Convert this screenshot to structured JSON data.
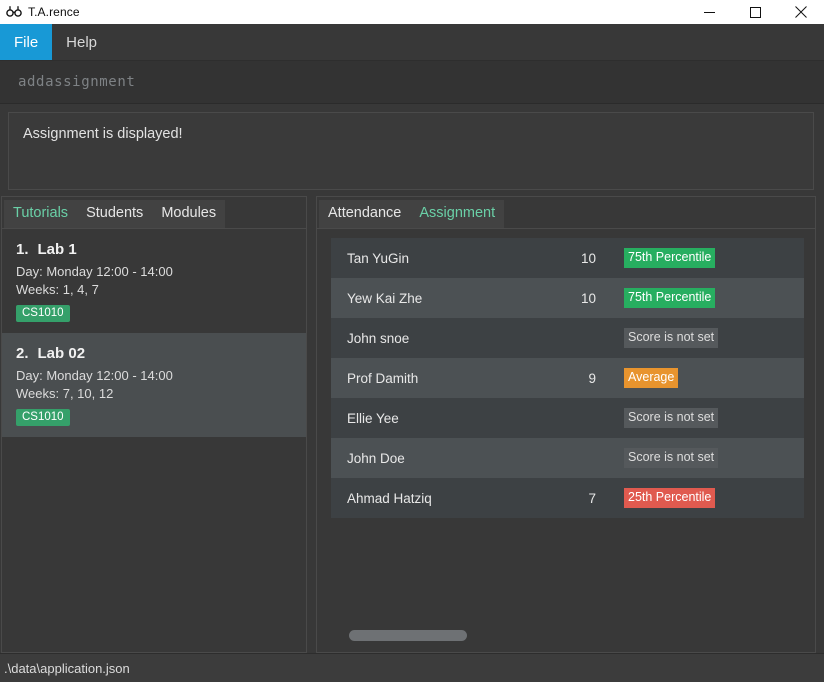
{
  "window": {
    "title": "T.A.rence",
    "app_icon": "glasses-icon",
    "controls": {
      "minimize": "minimize-icon",
      "maximize": "maximize-icon",
      "close": "close-icon"
    }
  },
  "menubar": {
    "items": [
      {
        "label": "File",
        "active": true
      },
      {
        "label": "Help",
        "active": false
      }
    ]
  },
  "command": {
    "value": "addassignment",
    "placeholder": "Enter command here..."
  },
  "result": {
    "message": "Assignment is displayed!"
  },
  "left_panel": {
    "tabs": [
      {
        "label": "Tutorials",
        "active": true
      },
      {
        "label": "Students",
        "active": false
      },
      {
        "label": "Modules",
        "active": false
      }
    ],
    "tutorials": [
      {
        "index": "1.",
        "name": "Lab 1",
        "day": "Day: Monday 12:00 - 14:00",
        "weeks": "Weeks: 1, 4, 7",
        "module": "CS1010"
      },
      {
        "index": "2.",
        "name": "Lab 02",
        "day": "Day: Monday 12:00 - 14:00",
        "weeks": "Weeks: 7, 10, 12",
        "module": "CS1010"
      }
    ]
  },
  "right_panel": {
    "tabs": [
      {
        "label": "Attendance",
        "active": false
      },
      {
        "label": "Assignment",
        "active": true
      }
    ],
    "rows": [
      {
        "name": "Tan YuGin",
        "score": "10",
        "status": "75th Percentile",
        "status_kind": "good"
      },
      {
        "name": "Yew Kai Zhe",
        "score": "10",
        "status": "75th Percentile",
        "status_kind": "good"
      },
      {
        "name": "John snoe",
        "score": "",
        "status": "Score is not set",
        "status_kind": "none"
      },
      {
        "name": "Prof Damith",
        "score": "9",
        "status": "Average",
        "status_kind": "avg"
      },
      {
        "name": "Ellie Yee",
        "score": "",
        "status": "Score is not set",
        "status_kind": "none"
      },
      {
        "name": "John Doe",
        "score": "",
        "status": "Score is not set",
        "status_kind": "none"
      },
      {
        "name": "Ahmad Hatziq",
        "score": "7",
        "status": "25th Percentile",
        "status_kind": "bad"
      }
    ]
  },
  "statusbar": {
    "path": ".\\data\\application.json"
  },
  "colors": {
    "menu_accent": "#1899d6",
    "tab_active": "#6ad0a7",
    "badge_module": "#35a06a",
    "status_good": "#27ae60",
    "status_average": "#e8942e",
    "status_bad": "#e05a4f",
    "status_unset": "#55595c",
    "window_bg": "#383838"
  }
}
